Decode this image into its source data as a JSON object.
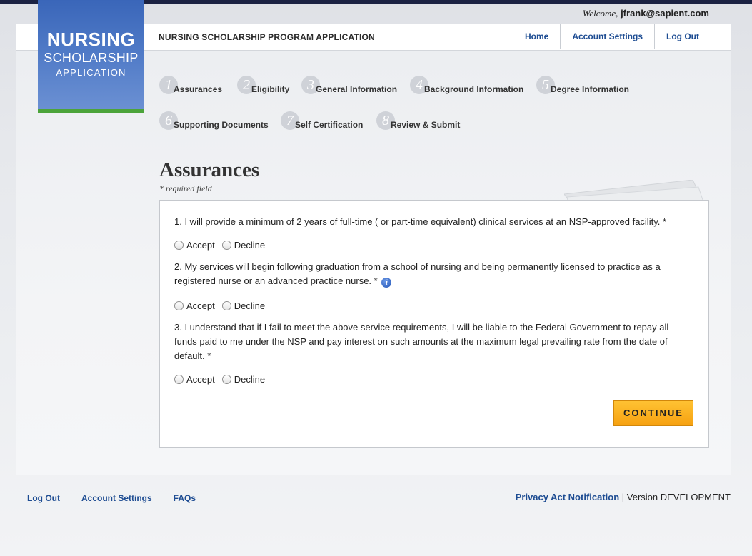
{
  "welcome": {
    "prefix": "Welcome,",
    "email": "jfrank@sapient.com"
  },
  "logo": {
    "line1": "NURSING",
    "line2": "SCHOLARSHIP",
    "line3": "APPLICATION"
  },
  "header": {
    "title": "NURSING SCHOLARSHIP PROGRAM APPLICATION",
    "nav": {
      "home": "Home",
      "account_settings": "Account Settings",
      "logout": "Log Out"
    }
  },
  "steps": [
    {
      "num": "1",
      "label": "Assurances"
    },
    {
      "num": "2",
      "label": "Eligibility"
    },
    {
      "num": "3",
      "label": "General Information"
    },
    {
      "num": "4",
      "label": "Background Information"
    },
    {
      "num": "5",
      "label": "Degree Information"
    },
    {
      "num": "6",
      "label": "Supporting Documents"
    },
    {
      "num": "7",
      "label": "Self Certification"
    },
    {
      "num": "8",
      "label": "Review & Submit"
    }
  ],
  "page": {
    "title": "Assurances",
    "required_note": "* required field"
  },
  "questions": [
    {
      "text": "1. I will provide a minimum of 2 years of full-time ( or part-time equivalent) clinical services at an NSP-approved facility. *"
    },
    {
      "text": "2. My services will begin following graduation from a school of nursing and being permanently licensed to practice as a registered nurse or an advanced practice nurse. *"
    },
    {
      "text": "3. I understand that if I fail to meet the above service requirements, I will be liable to the Federal Government to repay all funds paid to me under the NSP and pay interest on such amounts at the maximum legal prevailing rate from the date of default. *"
    }
  ],
  "options": {
    "accept": "Accept",
    "decline": "Decline"
  },
  "info_icon_glyph": "i",
  "continue_label": "CONTINUE",
  "footer": {
    "logout": "Log Out",
    "account_settings": "Account Settings",
    "faqs": "FAQs",
    "privacy": "Privacy Act Notification",
    "version": " | Version DEVELOPMENT"
  },
  "colors": {
    "link": "#1d4c92",
    "accent": "#f6a111",
    "logo_blue": "#3a66b9",
    "logo_green": "#4ca43a"
  }
}
